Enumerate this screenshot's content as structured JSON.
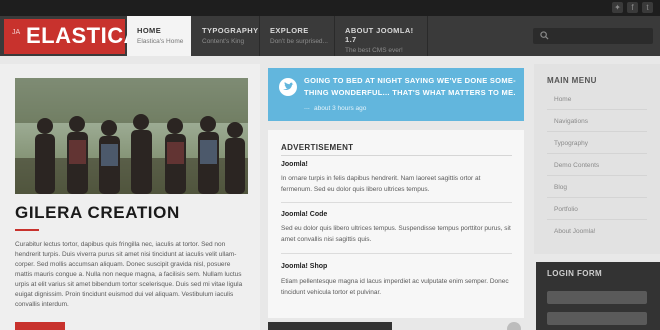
{
  "logo": {
    "ja": "JA",
    "name": "ELASTICA"
  },
  "nav": [
    {
      "label": "HOME",
      "sub": "Elastica's Home"
    },
    {
      "label": "TYPOGRAPHY",
      "sub": "Content's King"
    },
    {
      "label": "EXPLORE",
      "sub": "Don't be surprised..."
    },
    {
      "label": "ABOUT JOOMLA! 1.7",
      "sub": "The best CMS ever!"
    }
  ],
  "article": {
    "title": "GILERA CREATION",
    "body": "Curabitur lectus tortor, dapibus quis fringilla nec, iaculis at tortor. Sed non hendrerit turpis. Duis viverra purus sit amet nisi tincidunt at iaculis velit ullam-corper. Sed mollis accumsan aliquam. Donec suscipit gravida nisl, posuere mattis mauris congue a. Nulla non neque magna, a facilisis sem. Nullam luctus urpis at elit varius sit amet bibendum tortor scelerisque. Duis sed mi vitae ligula euigat dignissim. Proin tincidunt euismod dui vel aliquam. Vestibulum iaculis convallis interdum."
  },
  "tweet": {
    "text": "GOING TO BED AT NIGHT SAYING WE'VE DONE SOME-THING WONDERFUL... THAT'S WHAT MATTERS TO ME.",
    "dots": "...",
    "time": "about 3 hours ago"
  },
  "advertisement": {
    "heading": "ADVERTISEMENT",
    "items": [
      {
        "title": "Joomla!",
        "text": "In ornare turpis in felis dapibus hendrerit. Nam laoreet sagittis ortor at fermenum. Sed eu dolor quis libero ultrices tempus."
      },
      {
        "title": "Joomla! Code",
        "text": "Sed eu dolor quis libero ultrices tempus. Suspendisse tempus porttitor purus, sit amet convallis nisi sagittis quis."
      },
      {
        "title": "Joomla! Shop",
        "text": "Etiam pellentesque magna id lacus imperdiet ac vulputate enim semper. Donec tincidunt vehicula tortor et pulvinar."
      }
    ]
  },
  "main_menu": {
    "heading": "MAIN MENU",
    "items": [
      "Home",
      "Navigations",
      "Typography",
      "Demo Contents",
      "Blog",
      "Portfolio",
      "About Joomla!"
    ]
  },
  "login": {
    "heading": "LOGIN FORM"
  },
  "colors": {
    "accent": "#c8322d",
    "twitter": "#62b6dd",
    "header": "#3a3a3a"
  }
}
